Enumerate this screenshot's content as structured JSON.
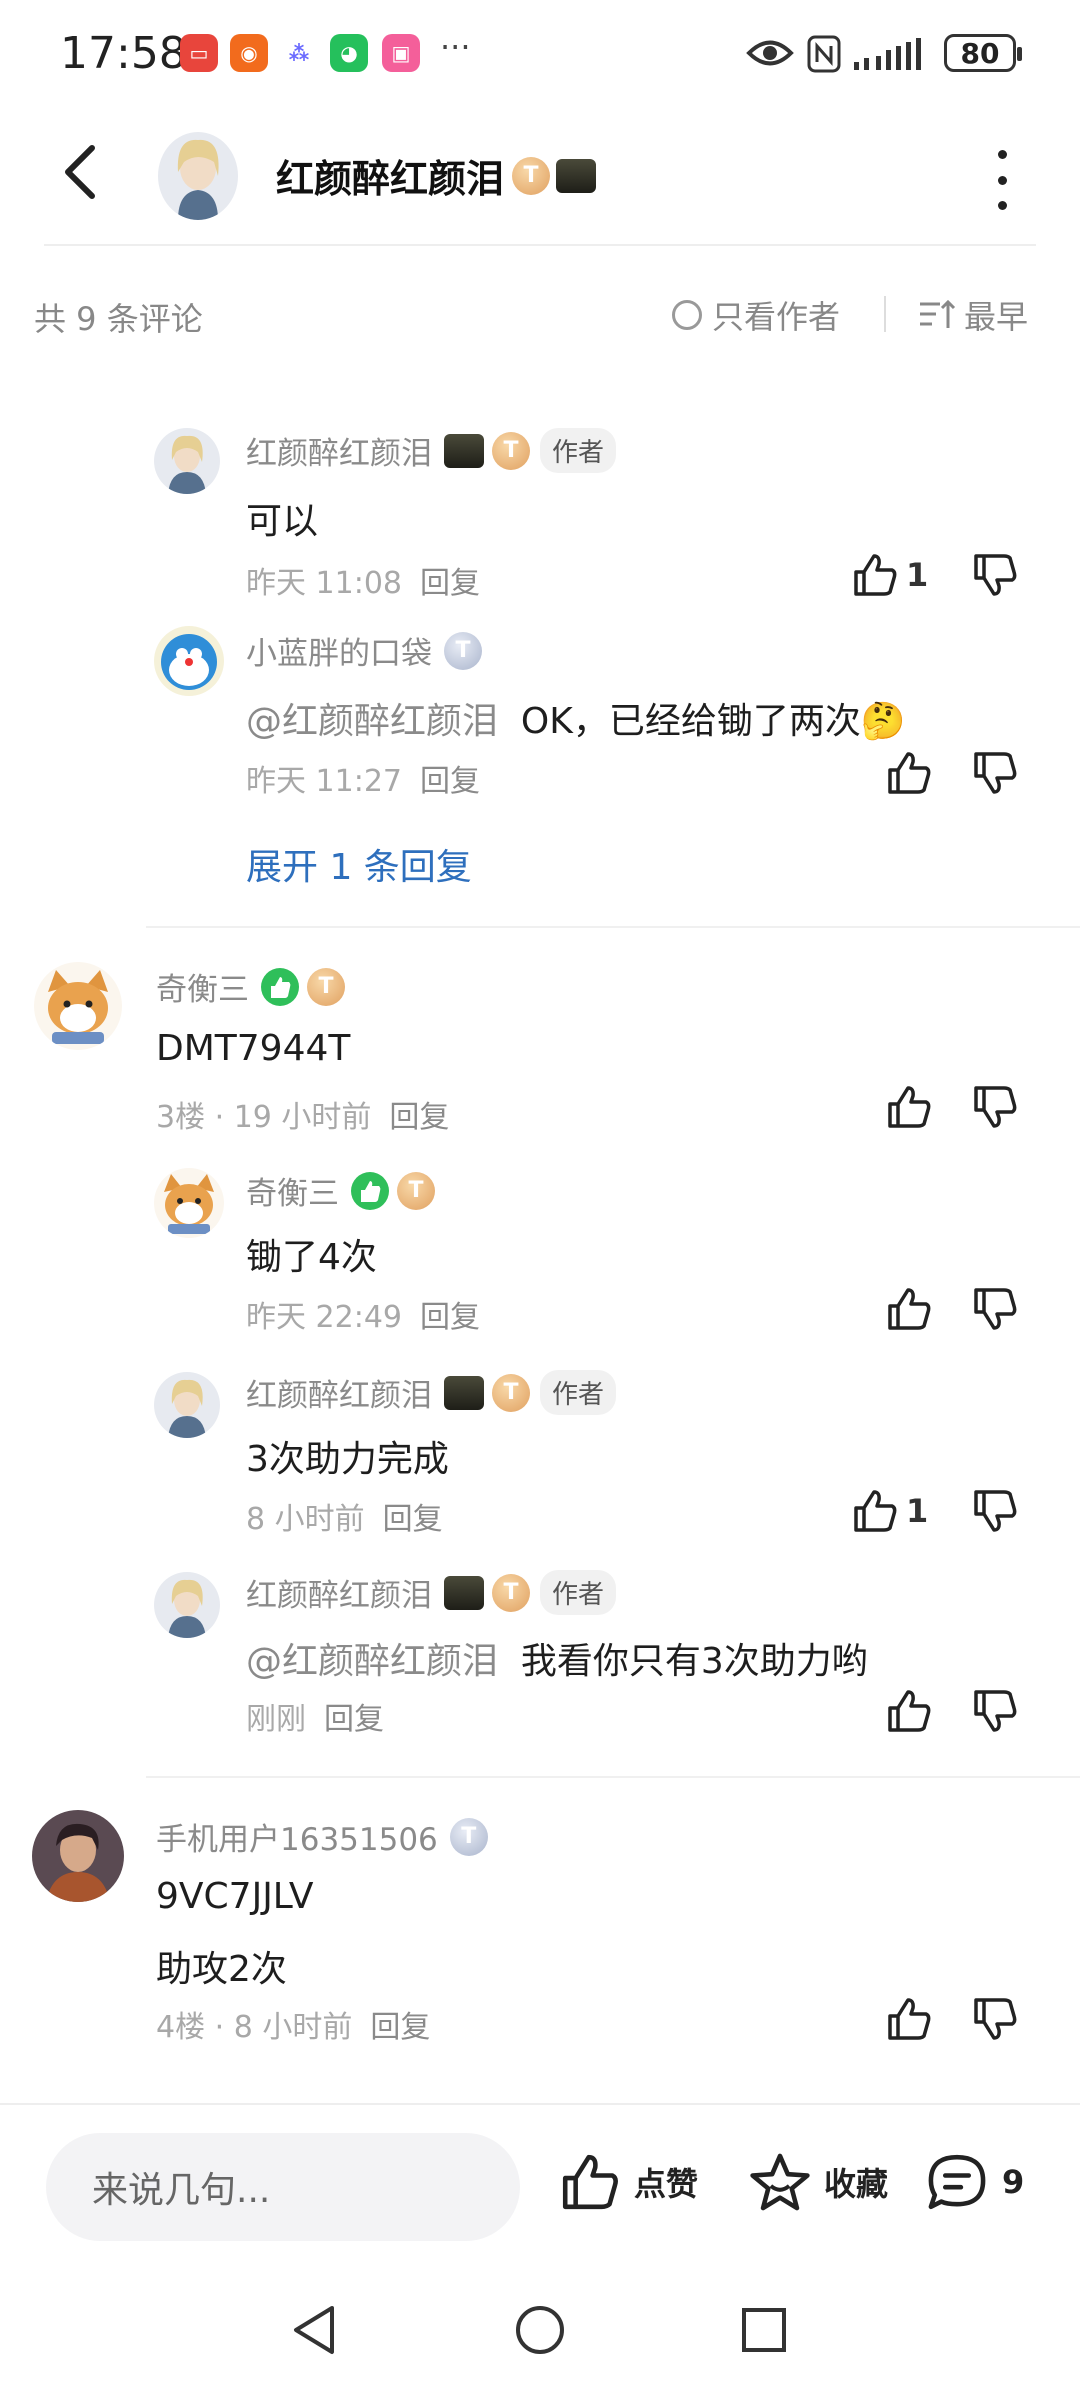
{
  "status_bar": {
    "time": "17:58",
    "more": "···",
    "battery": "80"
  },
  "header": {
    "title": "红颜醉红颜泪"
  },
  "sort_bar": {
    "count_label": "共 9 条评论",
    "only_author_label": "只看作者",
    "sort_label": "最早"
  },
  "comments": [
    {
      "name": "红颜醉红颜泪",
      "author_tag": "作者",
      "text": "可以",
      "time": "昨天 11:08",
      "reply": "回复",
      "likes": "1"
    },
    {
      "name": "小蓝胖的口袋",
      "mention": "@红颜醉红颜泪",
      "text": "OK，已经给锄了两次🤔",
      "time": "昨天 11:27",
      "reply": "回复"
    },
    {
      "expand": "展开 1 条回复"
    },
    {
      "name": "奇衡三",
      "text": "DMT7944T",
      "time": "3楼 · 19 小时前",
      "reply": "回复"
    },
    {
      "name": "奇衡三",
      "text": "锄了4次",
      "time": "昨天 22:49",
      "reply": "回复"
    },
    {
      "name": "红颜醉红颜泪",
      "author_tag": "作者",
      "text": "3次助力完成",
      "time": "8 小时前",
      "reply": "回复",
      "likes": "1"
    },
    {
      "name": "红颜醉红颜泪",
      "author_tag": "作者",
      "mention": "@红颜醉红颜泪",
      "text": "我看你只有3次助力哟",
      "time": "刚刚",
      "reply": "回复"
    },
    {
      "name": "手机用户16351506",
      "text": "9VC7JJLV",
      "text2": "助攻2次",
      "time": "4楼 · 8 小时前",
      "reply": "回复"
    }
  ],
  "badges": {
    "t5": "T",
    "t3": "T"
  },
  "bottom_bar": {
    "input_placeholder": "来说几句...",
    "like_label": "点赞",
    "collect_label": "收藏",
    "comment_count": "9"
  },
  "colors": {
    "link": "#2e6fbd",
    "secondary_text": "#8a8a8a",
    "green_badge": "#2fbf5a"
  }
}
